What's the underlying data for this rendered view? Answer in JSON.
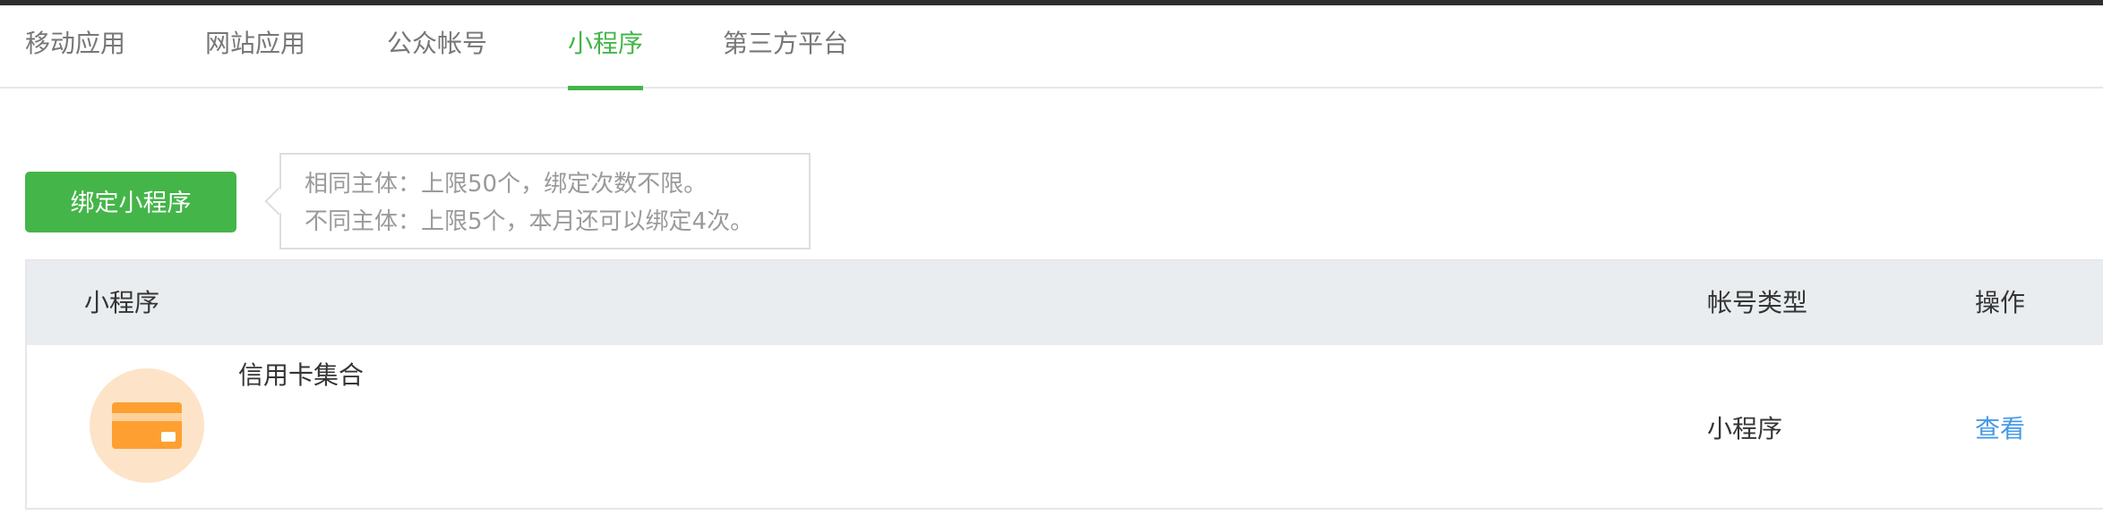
{
  "tabs": [
    {
      "label": "移动应用",
      "active": false
    },
    {
      "label": "网站应用",
      "active": false
    },
    {
      "label": "公众帐号",
      "active": false
    },
    {
      "label": "小程序",
      "active": true
    },
    {
      "label": "第三方平台",
      "active": false
    }
  ],
  "bind_button": {
    "label": "绑定小程序"
  },
  "tip": {
    "line1": "相同主体：上限50个，绑定次数不限。",
    "line2": "不同主体：上限5个，本月还可以绑定4次。"
  },
  "table": {
    "headers": {
      "name": "小程序",
      "type": "帐号类型",
      "action": "操作"
    },
    "rows": [
      {
        "icon": "credit-card-icon",
        "name": "信用卡集合",
        "type": "小程序",
        "action": "查看"
      }
    ]
  },
  "colors": {
    "accent": "#44b549",
    "link": "#459ae9",
    "icon_bg": "#fde3c8",
    "icon_fg": "#fda031"
  }
}
